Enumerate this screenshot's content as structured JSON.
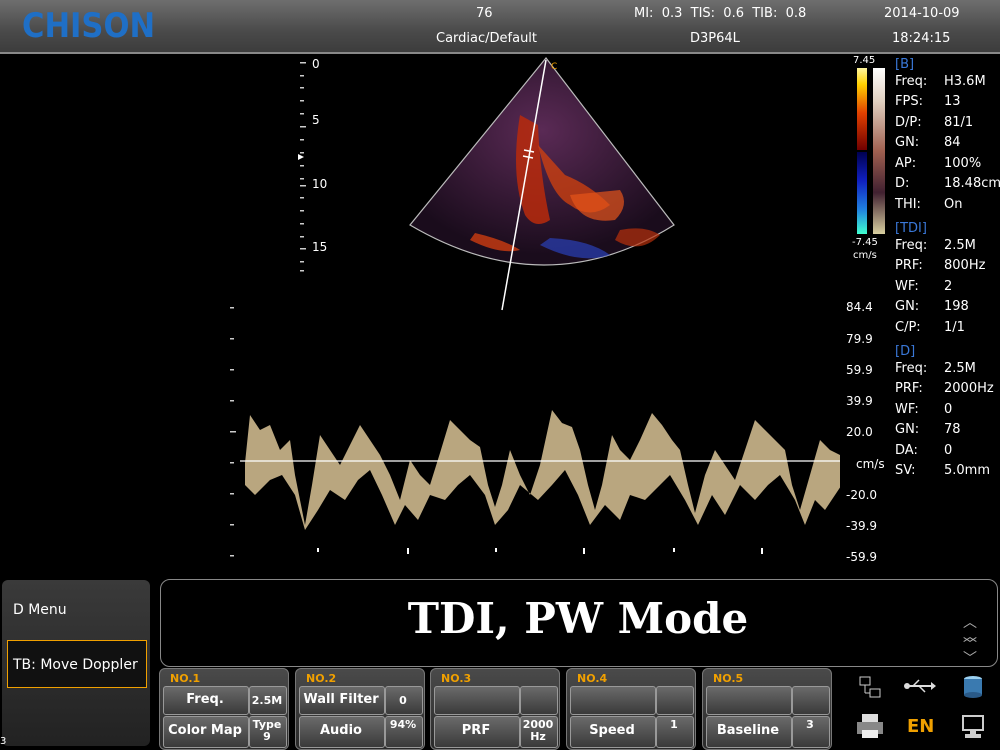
{
  "header": {
    "logo": "CHISON",
    "frame": "76",
    "preset": "Cardiac/Default",
    "mi": "MI:  0.3  TIS:  0.6  TIB:  0.8",
    "probe": "D3P64L",
    "date": "2014-10-09",
    "time": "18:24:15"
  },
  "depth_scale": [
    "0",
    "5",
    "10",
    "15"
  ],
  "color_bar": {
    "top": "7.45",
    "bottom": "-7.45",
    "unit": "cm/s"
  },
  "params": [
    {
      "type": "section",
      "text": "[B]"
    },
    {
      "label": "Freq:",
      "value": "H3.6M"
    },
    {
      "label": "FPS:",
      "value": "13"
    },
    {
      "label": "D/P:",
      "value": "81/1"
    },
    {
      "label": "GN:",
      "value": "84"
    },
    {
      "label": "AP:",
      "value": "100%"
    },
    {
      "label": "D:",
      "value": "18.48cm"
    },
    {
      "label": "THI:",
      "value": "On"
    },
    {
      "type": "section",
      "text": "[TDI]"
    },
    {
      "label": "Freq:",
      "value": "2.5M"
    },
    {
      "label": "PRF:",
      "value": "800Hz"
    },
    {
      "label": "WF:",
      "value": "2"
    },
    {
      "label": "GN:",
      "value": "198"
    },
    {
      "label": "C/P:",
      "value": "1/1"
    },
    {
      "type": "section",
      "text": "[D]"
    },
    {
      "label": "Freq:",
      "value": "2.5M"
    },
    {
      "label": "PRF:",
      "value": "2000Hz"
    },
    {
      "label": "WF:",
      "value": "0"
    },
    {
      "label": "GN:",
      "value": "78"
    },
    {
      "label": "DA:",
      "value": "0"
    },
    {
      "label": "SV:",
      "value": "5.0mm"
    }
  ],
  "velocity_scale": [
    "84.4",
    "79.9",
    "59.9",
    "39.9",
    "20.0",
    "cm/s",
    "-20.0",
    "-39.9",
    "-59.9"
  ],
  "side_menu": {
    "item1": "D Menu",
    "item2": "TB: Move Doppler"
  },
  "message": "TDI, PW Mode",
  "knobs": [
    {
      "no": "NO.1",
      "top_label": "Freq.",
      "top_value": "2.5M",
      "bottom_label": "Color Map",
      "bottom_value": "Type9"
    },
    {
      "no": "NO.2",
      "top_label": "Wall Filter",
      "top_value": "0",
      "bottom_label": "Audio",
      "bottom_value": "94%"
    },
    {
      "no": "NO.3",
      "top_label": "",
      "top_value": "",
      "bottom_label": "PRF",
      "bottom_value": "2000Hz"
    },
    {
      "no": "NO.4",
      "top_label": "",
      "top_value": "",
      "bottom_label": "Speed",
      "bottom_value": "1"
    },
    {
      "no": "NO.5",
      "top_label": "",
      "top_value": "",
      "bottom_label": "Baseline",
      "bottom_value": "3"
    }
  ],
  "system_icons": {
    "lang": "EN",
    "icons": [
      "network-icon",
      "usb-icon",
      "storage-icon",
      "printer-icon",
      "language-icon",
      "computer-icon"
    ]
  },
  "corner_label": "3"
}
